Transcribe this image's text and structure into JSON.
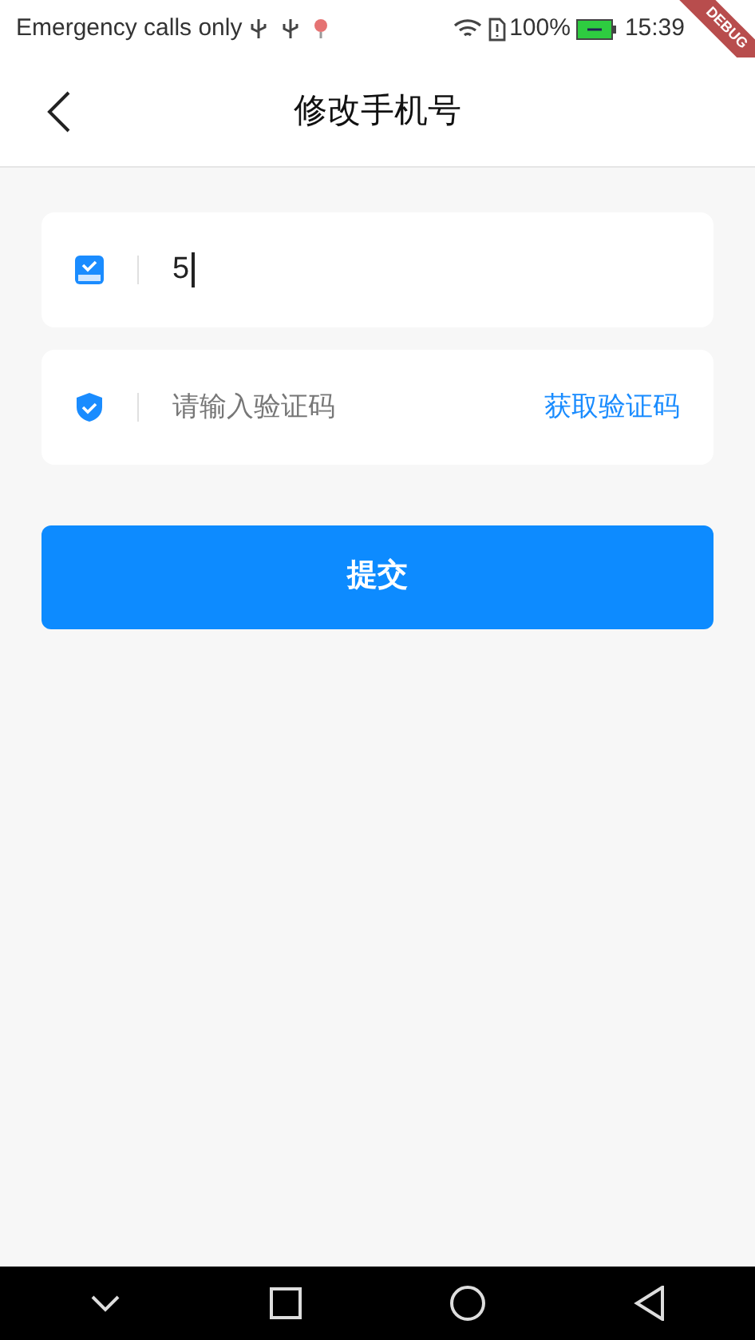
{
  "status_bar": {
    "carrier": "Emergency calls only",
    "battery": "100%",
    "time": "15:39"
  },
  "debug_banner": "DEBUG",
  "app_bar": {
    "title": "修改手机号"
  },
  "phone_field": {
    "value": "5"
  },
  "code_field": {
    "placeholder": "请输入验证码",
    "action": "获取验证码"
  },
  "submit_button": "提交"
}
